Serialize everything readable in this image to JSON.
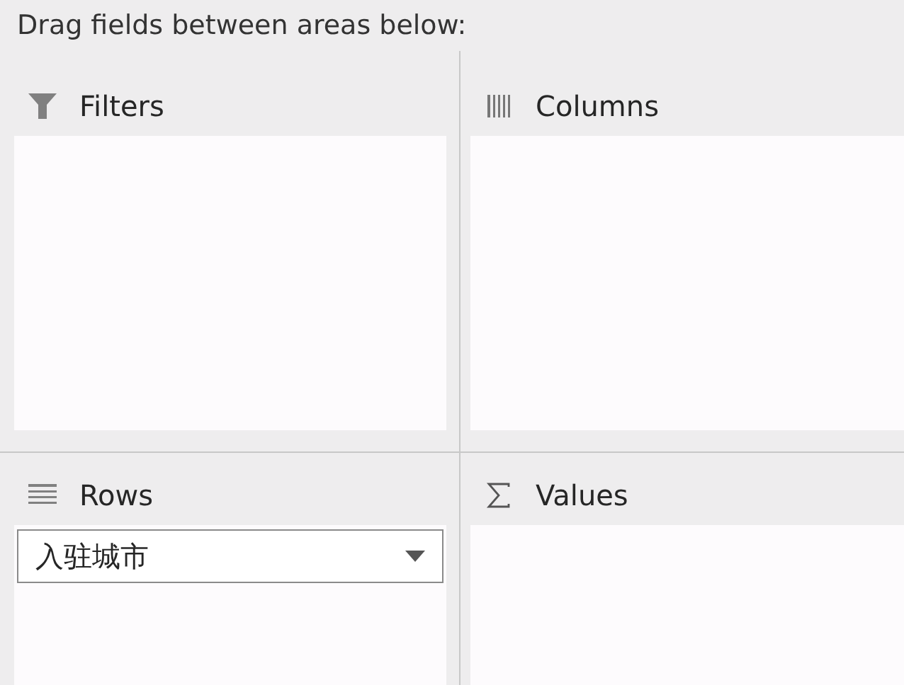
{
  "instruction": "Drag fields between areas below:",
  "areas": [
    {
      "kind": "filters",
      "label": "Filters"
    },
    {
      "kind": "columns",
      "label": "Columns"
    },
    {
      "kind": "rows",
      "label": "Rows",
      "fields": [
        {
          "name": "入驻城市"
        }
      ]
    },
    {
      "kind": "values",
      "label": "Values"
    }
  ]
}
